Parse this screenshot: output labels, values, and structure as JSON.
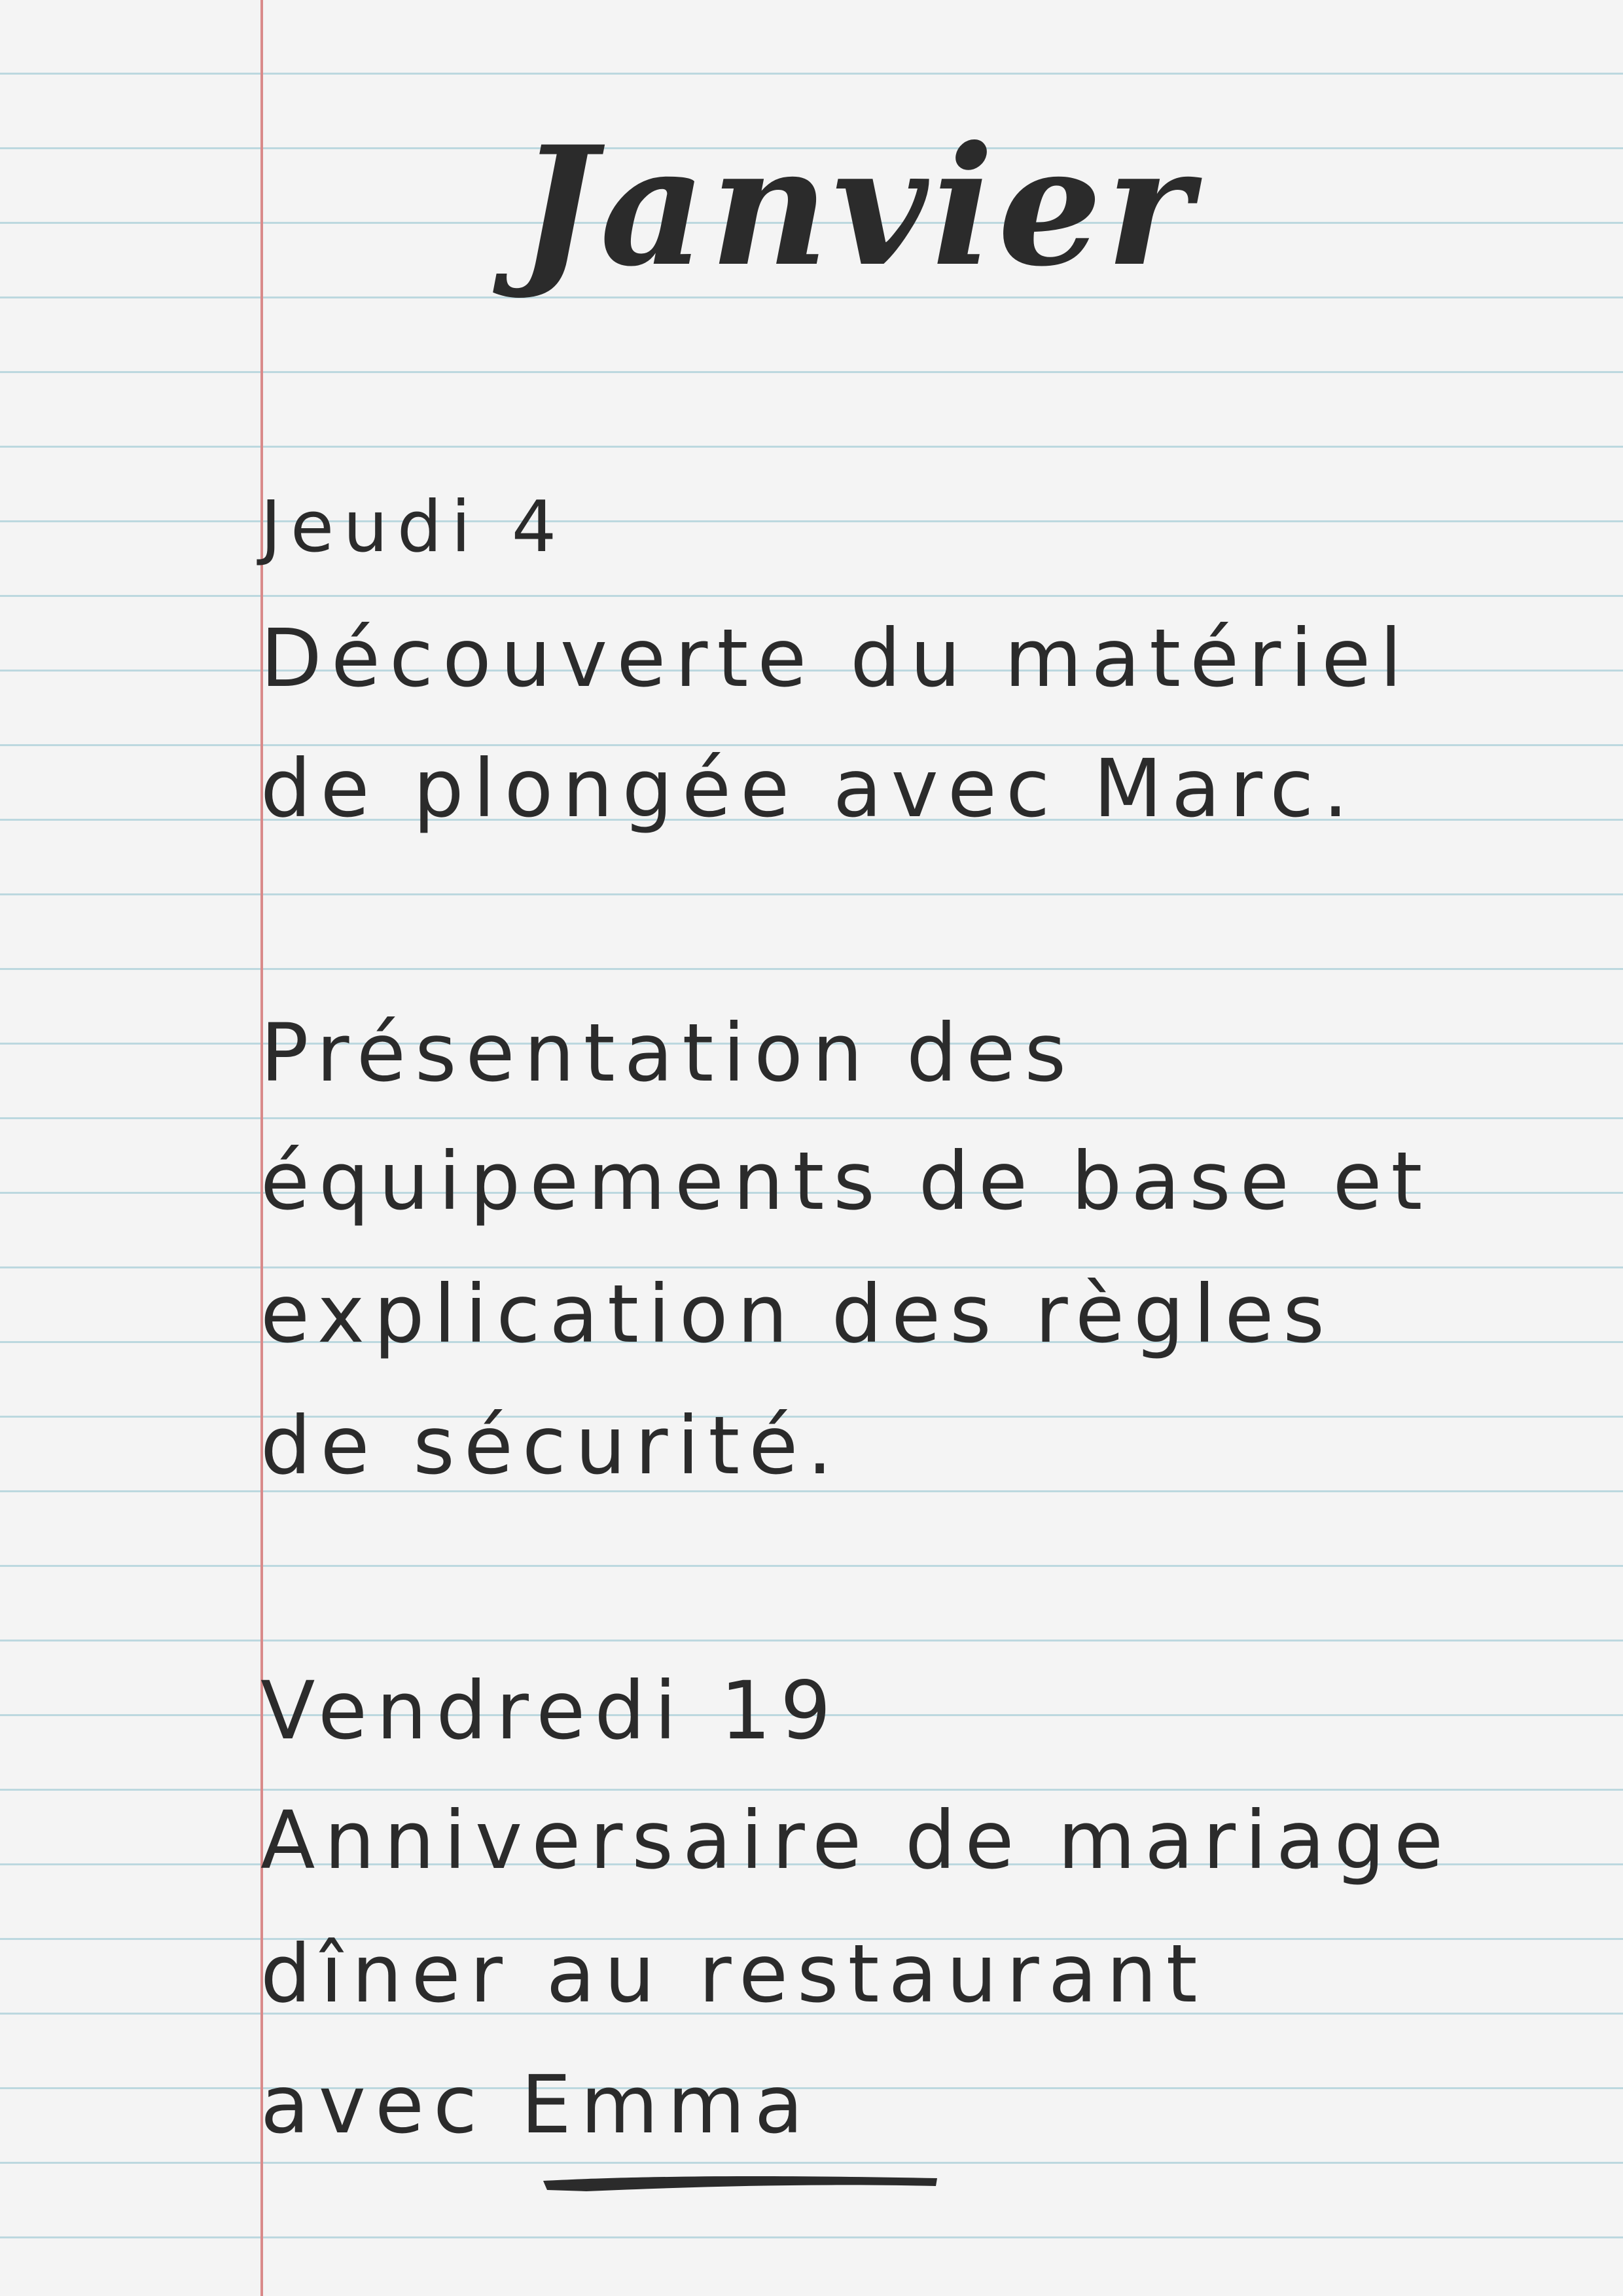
{
  "page": {
    "title": "Janvier",
    "entries": [
      {
        "date": "Jeudi 4",
        "lines": [
          "Découverte du matériel",
          "de plongée avec Marc."
        ]
      },
      {
        "lines": [
          "Présentation des",
          "équipements de base et",
          "explication des règles",
          "de sécurité."
        ]
      },
      {
        "date": "Vendredi 19",
        "lines": [
          "Anniversaire de mariage",
          "dîner au restaurant",
          "avec Emma"
        ]
      }
    ]
  },
  "colors": {
    "paper": "#f4f4f4",
    "rule_line": "#bcd8df",
    "margin_line": "#d98a8a",
    "ink": "#2b2b2b"
  }
}
